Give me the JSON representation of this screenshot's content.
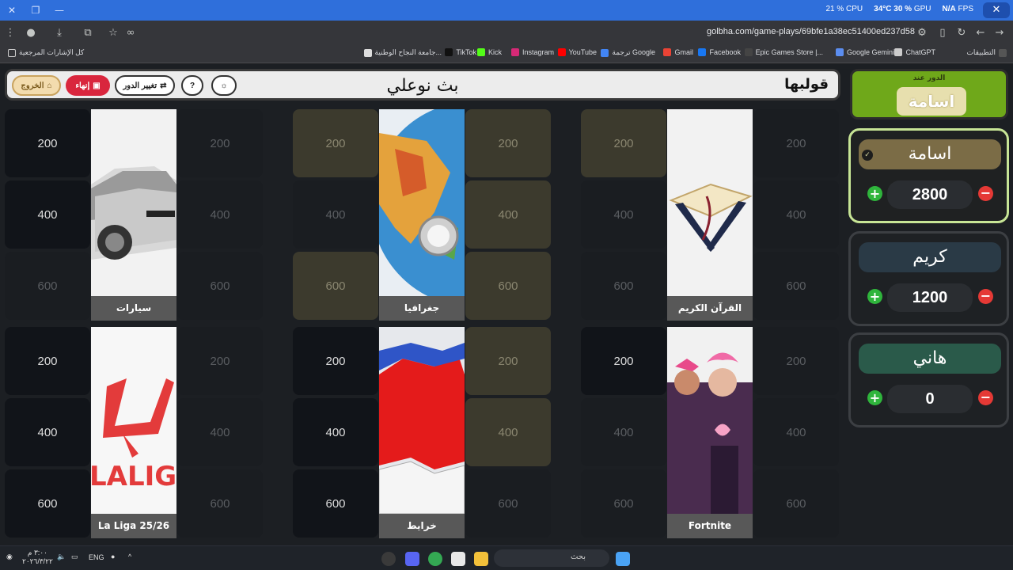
{
  "browser": {
    "overlay": {
      "fps_label": "FPS",
      "fps_value": "N/A",
      "gpu_label": "GPU",
      "gpu_value": "30 %",
      "gpu_temp": "34°C",
      "cpu_label": "CPU",
      "cpu_value": "21 %"
    },
    "tab_title": "قولبها",
    "url": "golbha.com/game-plays/69bfe1a38ec51400ed237d58",
    "bookmarks_right": [
      "التطبيقات",
      "ChatGPT",
      "Google Gemini",
      "Epic Games Store |...",
      "Facebook",
      "Gmail",
      "ترجمة Google",
      "YouTube",
      "Instagram",
      "Kick",
      "TikTok",
      "جامعة النجاح الوطنية..."
    ],
    "bookmarks_folder": "كل الإشارات المرجعية"
  },
  "game": {
    "logo": "قولبها",
    "title": "بث نوعلي",
    "buttons": {
      "exit": "الخروج",
      "end": "إنهاء",
      "change_turn": "تغيير الدور"
    },
    "categories": [
      {
        "name": "القرآن الكريم",
        "icon": "quran-image"
      },
      {
        "name": "جغرافيا",
        "icon": "globe-image"
      },
      {
        "name": "سيارات",
        "icon": "car-image"
      },
      {
        "name": "Fortnite",
        "icon": "fortnite-image"
      },
      {
        "name": "خرايط",
        "icon": "map-image"
      },
      {
        "name": "La Liga 25/26",
        "icon": "laliga-image"
      }
    ],
    "points": [
      "200",
      "400",
      "600"
    ],
    "turn": {
      "caption": "الدور عند",
      "name": "اسامة"
    },
    "teams": [
      {
        "name": "اسامة",
        "score": "2800",
        "color": "#7b6c46",
        "active": true
      },
      {
        "name": "كريم",
        "score": "1200",
        "color": "#2a3a46",
        "active": false
      },
      {
        "name": "هاني",
        "score": "0",
        "color": "#2a5a4a",
        "active": false
      }
    ]
  },
  "taskbar": {
    "time": "٣:٠٠ م",
    "date": "٢٠٢٦/٣/٢٢",
    "lang": "ENG",
    "search_placeholder": "بحث"
  }
}
